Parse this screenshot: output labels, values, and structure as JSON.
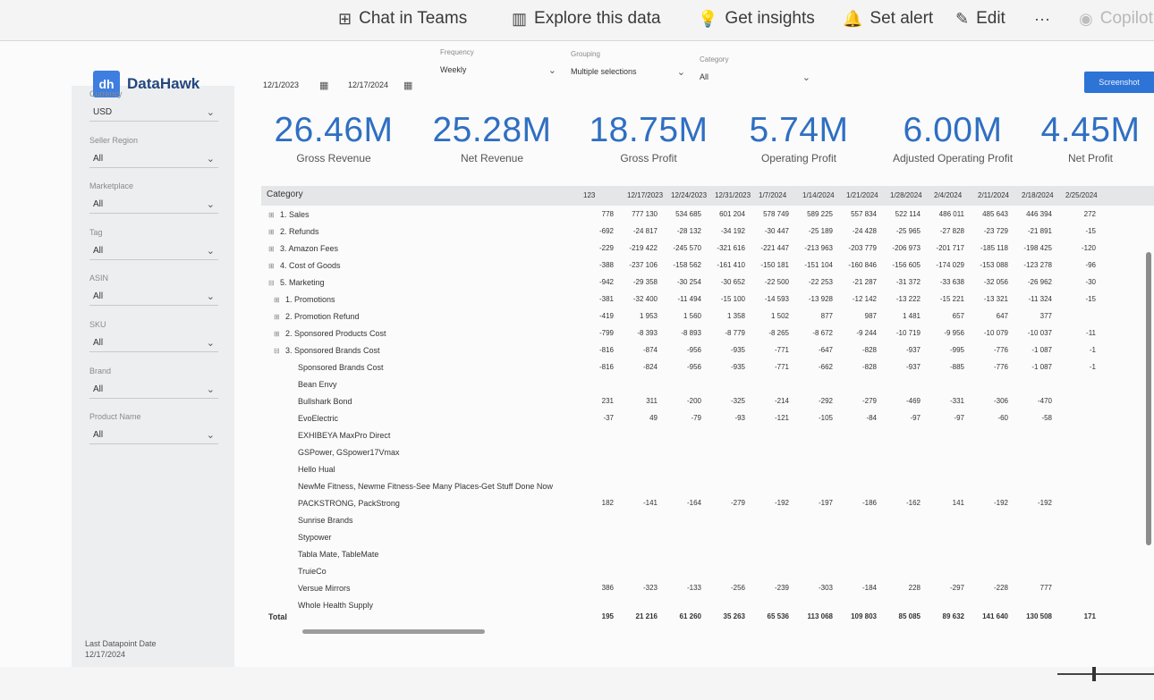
{
  "commands": [
    {
      "icon": "⊞",
      "label": "Chat in Teams",
      "icon_name": "teams-icon"
    },
    {
      "icon": "▥",
      "label": "Explore this data",
      "icon_name": "explore-icon"
    },
    {
      "icon": "💡",
      "label": "Get insights",
      "icon_name": "lightbulb-icon"
    },
    {
      "icon": "🔔",
      "label": "Set alert",
      "icon_name": "bell-icon"
    },
    {
      "icon": "✎",
      "label": "Edit",
      "icon_name": "pencil-icon"
    },
    {
      "icon": "···",
      "label": "",
      "icon_name": "more-icon"
    },
    {
      "icon": "◉",
      "label": "Copilot",
      "icon_name": "copilot-icon"
    }
  ],
  "logo": {
    "mark": "dh",
    "text": "DataHawk"
  },
  "dates": {
    "start": "12/1/2023",
    "end": "12/17/2024"
  },
  "top_filters": {
    "frequency": {
      "label": "Frequency",
      "value": "Weekly"
    },
    "grouping": {
      "label": "Grouping",
      "value": "Multiple selections"
    },
    "category": {
      "label": "Category",
      "value": "All"
    }
  },
  "top_button": "Screenshot",
  "slicers": [
    {
      "label": "Currency",
      "value": "USD"
    },
    {
      "label": "Seller Region",
      "value": "All"
    },
    {
      "label": "Marketplace",
      "value": "All"
    },
    {
      "label": "Tag",
      "value": "All"
    },
    {
      "label": "ASIN",
      "value": "All"
    },
    {
      "label": "SKU",
      "value": "All"
    },
    {
      "label": "Brand",
      "value": "All"
    },
    {
      "label": "Product Name",
      "value": "All"
    }
  ],
  "last_update": {
    "label": "Last Datapoint Date",
    "value": "12/17/2024"
  },
  "kpis": [
    {
      "value": "26.46M",
      "label": "Gross Revenue"
    },
    {
      "value": "25.28M",
      "label": "Net Revenue"
    },
    {
      "value": "18.75M",
      "label": "Gross Profit"
    },
    {
      "value": "5.74M",
      "label": "Operating Profit"
    },
    {
      "value": "6.00M",
      "label": "Adjusted Operating Profit"
    },
    {
      "value": "4.45M",
      "label": "Net Profit"
    }
  ],
  "matrix": {
    "category_header": "Category",
    "columns": [
      "123",
      "12/17/2023",
      "12/24/2023",
      "12/31/2023",
      "1/7/2024",
      "1/14/2024",
      "1/21/2024",
      "1/28/2024",
      "2/4/2024",
      "2/11/2024",
      "2/18/2024",
      "2/25/2024"
    ],
    "rows": [
      {
        "label": "1. Sales",
        "toggle": "⊞",
        "values": [
          "778",
          "777 130",
          "534 685",
          "601 204",
          "578 749",
          "589 225",
          "557 834",
          "522 114",
          "486 011",
          "485 643",
          "446 394",
          "272"
        ]
      },
      {
        "label": "2. Refunds",
        "toggle": "⊞",
        "values": [
          "-692",
          "-24 817",
          "-28 132",
          "-34 192",
          "-30 447",
          "-25 189",
          "-24 428",
          "-25 965",
          "-27 828",
          "-23 729",
          "-21 891",
          "-15"
        ]
      },
      {
        "label": "3. Amazon Fees",
        "toggle": "⊞",
        "values": [
          "-229",
          "-219 422",
          "-245 570",
          "-321 616",
          "-221 447",
          "-213 963",
          "-203 779",
          "-206 973",
          "-201 717",
          "-185 118",
          "-198 425",
          "-120"
        ]
      },
      {
        "label": "4. Cost of Goods",
        "toggle": "⊞",
        "values": [
          "-388",
          "-237 106",
          "-158 562",
          "-161 410",
          "-150 181",
          "-151 104",
          "-160 846",
          "-156 605",
          "-174 029",
          "-153 088",
          "-123 278",
          "-96"
        ]
      },
      {
        "label": "5. Marketing",
        "toggle": "⊟",
        "values": [
          "-942",
          "-29 358",
          "-30 254",
          "-30 652",
          "-22 500",
          "-22 253",
          "-21 287",
          "-31 372",
          "-33 638",
          "-32 056",
          "-26 962",
          "-30"
        ]
      },
      {
        "label": "1. Promotions",
        "toggle": "⊞",
        "indent": 1,
        "values": [
          "-381",
          "-32 400",
          "-11 494",
          "-15 100",
          "-14 593",
          "-13 928",
          "-12 142",
          "-13 222",
          "-15 221",
          "-13 321",
          "-11 324",
          "-15"
        ]
      },
      {
        "label": "2. Promotion Refund",
        "toggle": "⊞",
        "indent": 1,
        "values": [
          "-419",
          "1 953",
          "1 560",
          "1 358",
          "1 502",
          "877",
          "987",
          "1 481",
          "657",
          "647",
          "377",
          ""
        ]
      },
      {
        "label": "2. Sponsored Products Cost",
        "toggle": "⊞",
        "indent": 1,
        "values": [
          "-799",
          "-8 393",
          "-8 893",
          "-8 779",
          "-8 265",
          "-8 672",
          "-9 244",
          "-10 719",
          "-9 956",
          "-10 079",
          "-10 037",
          "-11"
        ]
      },
      {
        "label": "3. Sponsored Brands Cost",
        "toggle": "⊟",
        "indent": 1,
        "values": [
          "-816",
          "-874",
          "-956",
          "-935",
          "-771",
          "-647",
          "-828",
          "-937",
          "-995",
          "-776",
          "-1 087",
          "-1"
        ]
      },
      {
        "label": "Sponsored Brands Cost",
        "toggle": "",
        "indent": 2,
        "values": [
          "-816",
          "-824",
          "-956",
          "-935",
          "-771",
          "-662",
          "-828",
          "-937",
          "-885",
          "-776",
          "-1 087",
          "-1"
        ]
      },
      {
        "label": "Bean Envy",
        "toggle": "",
        "indent": 2,
        "values": [
          "",
          "",
          "",
          "",
          "",
          "",
          "",
          "",
          "",
          "",
          "",
          ""
        ]
      },
      {
        "label": "Bullshark Bond",
        "toggle": "",
        "indent": 2,
        "values": [
          "231",
          "311",
          "-200",
          "-325",
          "-214",
          "-292",
          "-279",
          "-469",
          "-331",
          "-306",
          "-470",
          ""
        ]
      },
      {
        "label": "EvoElectric",
        "toggle": "",
        "indent": 2,
        "values": [
          "-37",
          "49",
          "-79",
          "-93",
          "-121",
          "-105",
          "-84",
          "-97",
          "-97",
          "-60",
          "-58",
          ""
        ]
      },
      {
        "label": "EXHIBEYA MaxPro Direct",
        "toggle": "",
        "indent": 2,
        "values": [
          "",
          "",
          "",
          "",
          "",
          "",
          "",
          "",
          "",
          "",
          "",
          ""
        ]
      },
      {
        "label": "GSPower, GSpower17Vmax",
        "toggle": "",
        "indent": 2,
        "values": [
          "",
          "",
          "",
          "",
          "",
          "",
          "",
          "",
          "",
          "",
          "",
          ""
        ]
      },
      {
        "label": "Hello Hual",
        "toggle": "",
        "indent": 2,
        "values": [
          "",
          "",
          "",
          "",
          "",
          "",
          "",
          "",
          "",
          "",
          "",
          ""
        ]
      },
      {
        "label": "NewMe Fitness, Newme Fitness-See Many Places-Get Stuff Done Now",
        "toggle": "",
        "indent": 2,
        "values": [
          "",
          "",
          "",
          "",
          "",
          "",
          "",
          "",
          "",
          "",
          "",
          ""
        ]
      },
      {
        "label": "PACKSTRONG, PackStrong",
        "toggle": "",
        "indent": 2,
        "values": [
          "182",
          "-141",
          "-164",
          "-279",
          "-192",
          "-197",
          "-186",
          "-162",
          "141",
          "-192",
          "-192",
          ""
        ]
      },
      {
        "label": "Sunrise Brands",
        "toggle": "",
        "indent": 2,
        "values": [
          "",
          "",
          "",
          "",
          "",
          "",
          "",
          "",
          "",
          "",
          "",
          ""
        ]
      },
      {
        "label": "Stypower",
        "toggle": "",
        "indent": 2,
        "values": [
          "",
          "",
          "",
          "",
          "",
          "",
          "",
          "",
          "",
          "",
          "",
          ""
        ]
      },
      {
        "label": "Tabla Mate, TableMate",
        "toggle": "",
        "indent": 2,
        "values": [
          "",
          "",
          "",
          "",
          "",
          "",
          "",
          "",
          "",
          "",
          "",
          ""
        ]
      },
      {
        "label": "TruieCo",
        "toggle": "",
        "indent": 2,
        "values": [
          "",
          "",
          "",
          "",
          "",
          "",
          "",
          "",
          "",
          "",
          "",
          ""
        ]
      },
      {
        "label": "Versue Mirrors",
        "toggle": "",
        "indent": 2,
        "values": [
          "386",
          "-323",
          "-133",
          "-256",
          "-239",
          "-303",
          "-184",
          "228",
          "-297",
          "-228",
          "777",
          ""
        ]
      },
      {
        "label": "Whole Health Supply",
        "toggle": "",
        "indent": 2,
        "values": [
          "",
          "",
          "",
          "",
          "",
          "",
          "",
          "",
          "",
          "",
          "",
          ""
        ]
      }
    ],
    "total": {
      "label": "Total",
      "values": [
        "195",
        "21 216",
        "61 260",
        "35 263",
        "65 536",
        "113 068",
        "109 803",
        "85 085",
        "89 632",
        "141 640",
        "130 508",
        "171"
      ]
    }
  }
}
